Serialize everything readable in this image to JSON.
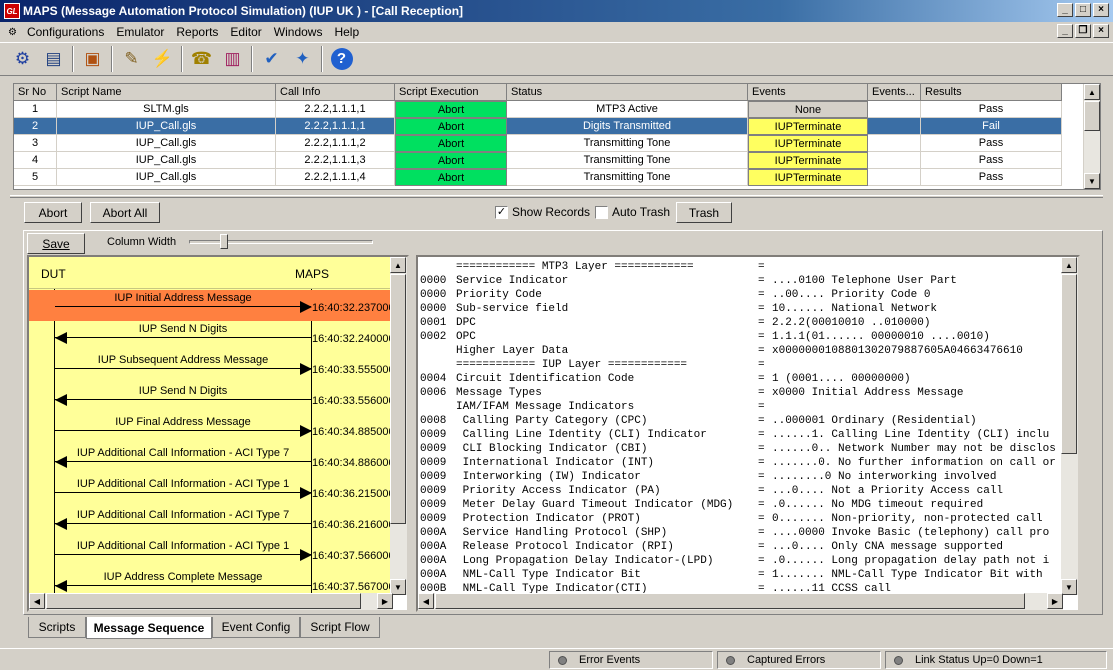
{
  "window": {
    "title": "MAPS (Message Automation Protocol Simulation)  (IUP UK ) - [Call Reception]",
    "logo": "GL"
  },
  "menu": [
    "Configurations",
    "Emulator",
    "Reports",
    "Editor",
    "Windows",
    "Help"
  ],
  "toolbar": [
    "gear-icon",
    "document-icon",
    "briefcase-icon",
    "edit-script-icon",
    "run-icon",
    "call-icon",
    "books-icon",
    "check-icon",
    "wizard-icon",
    "help-icon"
  ],
  "grid": {
    "columns": [
      "Sr No",
      "Script Name",
      "Call Info",
      "Script Execution",
      "Status",
      "Events",
      "Events...",
      "Results"
    ],
    "rows": [
      {
        "sr": "1",
        "script": "SLTM.gls",
        "call": "2.2.2,1.1.1,1",
        "exec": "Abort",
        "status": "MTP3 Active",
        "event": "None",
        "events2": "",
        "result": "Pass"
      },
      {
        "sr": "2",
        "script": "IUP_Call.gls",
        "call": "2.2.2,1.1.1,1",
        "exec": "Abort",
        "status": "Digits Transmitted",
        "event": "IUPTerminate",
        "events2": "",
        "result": "Fail"
      },
      {
        "sr": "3",
        "script": "IUP_Call.gls",
        "call": "2.2.2,1.1.1,2",
        "exec": "Abort",
        "status": "Transmitting Tone",
        "event": "IUPTerminate",
        "events2": "",
        "result": "Pass"
      },
      {
        "sr": "4",
        "script": "IUP_Call.gls",
        "call": "2.2.2,1.1.1,3",
        "exec": "Abort",
        "status": "Transmitting Tone",
        "event": "IUPTerminate",
        "events2": "",
        "result": "Pass"
      },
      {
        "sr": "5",
        "script": "IUP_Call.gls",
        "call": "2.2.2,1.1.1,4",
        "exec": "Abort",
        "status": "Transmitting Tone",
        "event": "IUPTerminate",
        "events2": "",
        "result": "Pass"
      }
    ]
  },
  "controls": {
    "abort": "Abort",
    "abort_all": "Abort All",
    "show_records": "Show Records",
    "show_records_checked": "✓",
    "auto_trash": "Auto Trash",
    "trash": "Trash",
    "save": "Save",
    "column_width": "Column Width",
    "column_width_level": 0.17
  },
  "sequence": {
    "left": "DUT",
    "right": "MAPS",
    "messages": [
      {
        "label": "IUP Initial Address Message",
        "dir": "right",
        "time": "16:40:32.237000"
      },
      {
        "label": "IUP Send N Digits",
        "dir": "left",
        "time": "16:40:32.240000"
      },
      {
        "label": "IUP Subsequent Address Message",
        "dir": "right",
        "time": "16:40:33.555000"
      },
      {
        "label": "IUP Send N Digits",
        "dir": "left",
        "time": "16:40:33.556000"
      },
      {
        "label": "IUP Final Address Message",
        "dir": "right",
        "time": "16:40:34.885000"
      },
      {
        "label": "IUP Additional Call Information - ACI Type 7",
        "dir": "left",
        "time": "16:40:34.886000"
      },
      {
        "label": "IUP Additional Call Information - ACI Type 1",
        "dir": "right",
        "time": "16:40:36.215000"
      },
      {
        "label": "IUP Additional Call Information - ACI Type 7",
        "dir": "left",
        "time": "16:40:36.216000"
      },
      {
        "label": "IUP Additional Call Information - ACI Type 1",
        "dir": "right",
        "time": "16:40:37.566000"
      },
      {
        "label": "IUP Address Complete Message",
        "dir": "left",
        "time": "16:40:37.567000"
      }
    ]
  },
  "decode": [
    [
      "",
      "============ MTP3 Layer ============",
      "=",
      ""
    ],
    [
      "0000",
      "Service Indicator",
      "=",
      "....0100 Telephone User Part"
    ],
    [
      "0000",
      "Priority Code",
      "=",
      "..00.... Priority Code 0"
    ],
    [
      "0000",
      "Sub-service field",
      "=",
      "10...... National Network"
    ],
    [
      "0001",
      "DPC",
      "=",
      "2.2.2(00010010 ..010000)"
    ],
    [
      "0002",
      "OPC",
      "=",
      "1.1.1(01...... 00000010 ....0010)"
    ],
    [
      "",
      "Higher Layer Data",
      "=",
      "x0000000108801302079887605A04663476610"
    ],
    [
      "",
      "============ IUP Layer ============",
      "=",
      ""
    ],
    [
      "0004",
      "Circuit Identification Code",
      "=",
      "1 (0001.... 00000000)"
    ],
    [
      "0006",
      "Message Types",
      "=",
      "x0000 Initial Address Message"
    ],
    [
      "",
      "IAM/IFAM Message Indicators",
      "=",
      ""
    ],
    [
      "0008",
      " Calling Party Category (CPC)",
      "=",
      "..000001 Ordinary (Residential)"
    ],
    [
      "0009",
      " Calling Line Identity (CLI) Indicator",
      "=",
      "......1. Calling Line Identity (CLI) inclu"
    ],
    [
      "0009",
      " CLI Blocking Indicator (CBI)",
      "=",
      "......0.. Network Number may not be disclos"
    ],
    [
      "0009",
      " International Indicator (INT)",
      "=",
      ".......0. No further information on call or"
    ],
    [
      "0009",
      " Interworking (IW) Indicator",
      "=",
      "........0 No interworking involved"
    ],
    [
      "0009",
      " Priority Access Indicator (PA)",
      "=",
      "...0.... Not a Priority Access call"
    ],
    [
      "0009",
      " Meter Delay Guard Timeout Indicator (MDG)",
      "=",
      ".0...... No MDG timeout required"
    ],
    [
      "0009",
      " Protection Indicator (PROT)",
      "=",
      "0....... Non-priority, non-protected call"
    ],
    [
      "000A",
      " Service Handling Protocol (SHP)",
      "=",
      "....0000 Invoke Basic (telephony) call pro"
    ],
    [
      "000A",
      " Release Protocol Indicator (RPI)",
      "=",
      "...0.... Only CNA message supported"
    ],
    [
      "000A",
      " Long Propagation Delay Indicator-(LPD)",
      "=",
      ".0...... Long propagation delay path not i"
    ],
    [
      "000A",
      " NML-Call Type Indicator Bit",
      "=",
      "1....... NML-Call Type Indicator Bit with"
    ],
    [
      "000B",
      " NML-Call Type Indicator(CTI)",
      "=",
      "......11 CCSS call"
    ]
  ],
  "tabs": [
    "Scripts",
    "Message Sequence",
    "Event Config",
    "Script Flow"
  ],
  "status": [
    "Error Events",
    "Captured Errors",
    "Link Status Up=0 Down=1"
  ]
}
